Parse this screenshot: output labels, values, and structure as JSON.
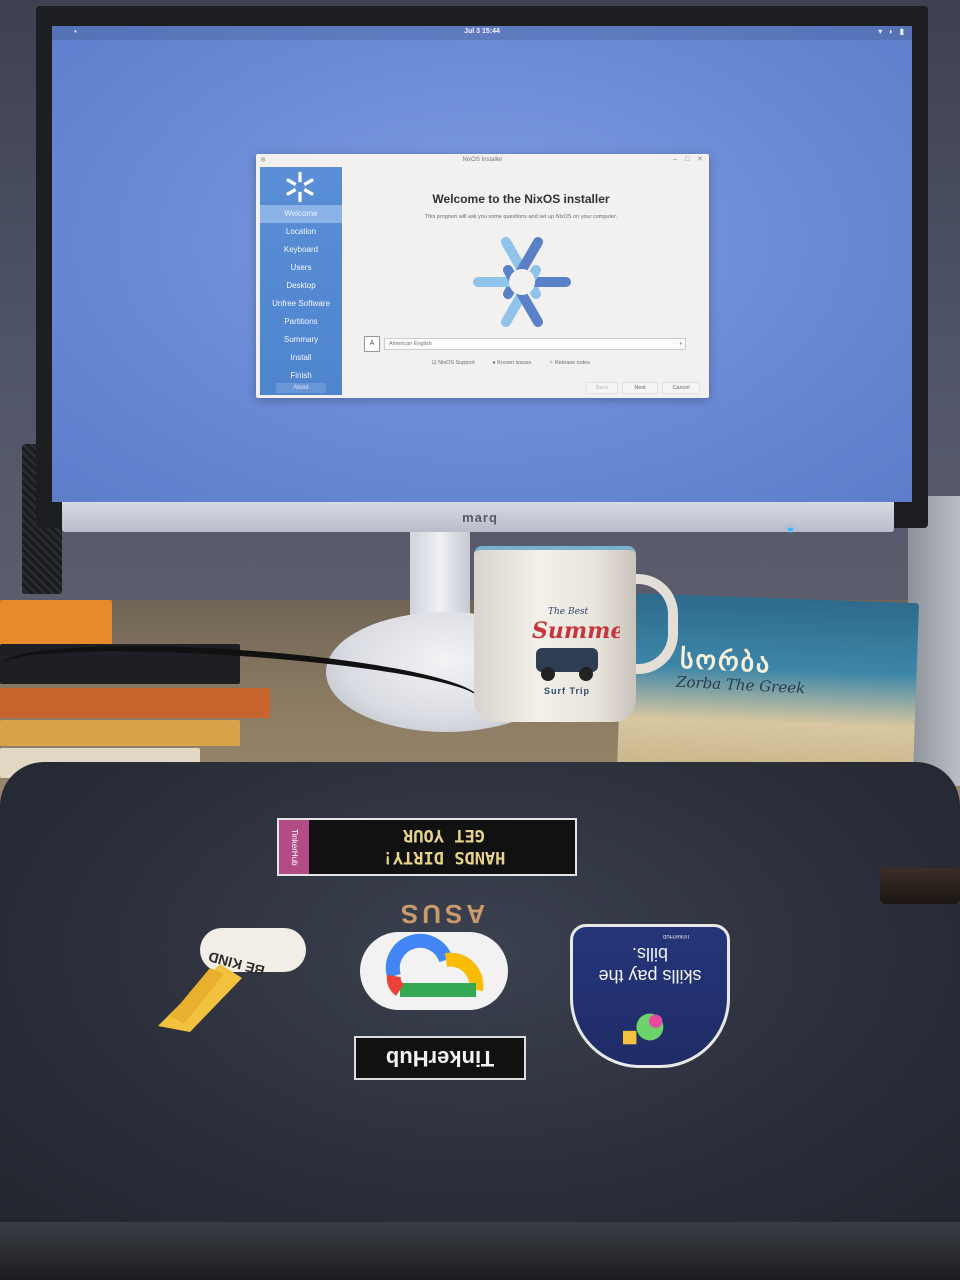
{
  "screen": {
    "clock": "Jul 3 15:44",
    "status_icons": "▾ ◗ ▮"
  },
  "monitor": {
    "brand": "marq"
  },
  "installer": {
    "window_title": "NixOS Installer",
    "heading": "Welcome to the NixOS installer",
    "subtitle": "This program will ask you some questions and set up NixOS on your computer.",
    "sidebar": [
      {
        "label": "Welcome",
        "active": true
      },
      {
        "label": "Location"
      },
      {
        "label": "Keyboard"
      },
      {
        "label": "Users"
      },
      {
        "label": "Desktop"
      },
      {
        "label": "Unfree Software"
      },
      {
        "label": "Partitions"
      },
      {
        "label": "Summary"
      },
      {
        "label": "Install"
      },
      {
        "label": "Finish"
      }
    ],
    "about_label": "About",
    "language_value": "American English",
    "links": {
      "support": "NixOS Support",
      "known_issues": "Known issues",
      "release_notes": "Release notes"
    },
    "buttons": {
      "back": "Back",
      "next": "Next",
      "cancel": "Cancel"
    }
  },
  "mug": {
    "line1": "The Best",
    "line2": "Summer",
    "line3": "Surf Trip"
  },
  "book": {
    "title": "სორბა",
    "subtitle": "Zorba The Greek"
  },
  "laptop": {
    "brand": "ASUS",
    "sticker_hands_line1": "GET YOUR",
    "sticker_hands_line2": "HANDS DIRTY!",
    "sticker_hands_tab": "TinkerHub",
    "sticker_bekind": "BE KIND",
    "sticker_skills": "skills pay the bills.",
    "sticker_skills_small": "TinkerHub",
    "sticker_tinkerhub": "TinkerHub"
  },
  "colors": {
    "desktop_bg": "#6a8ad6",
    "sidebar_bg": "#5a8fd6",
    "nix_light": "#8fc3ea",
    "nix_dark": "#5a80c8"
  }
}
